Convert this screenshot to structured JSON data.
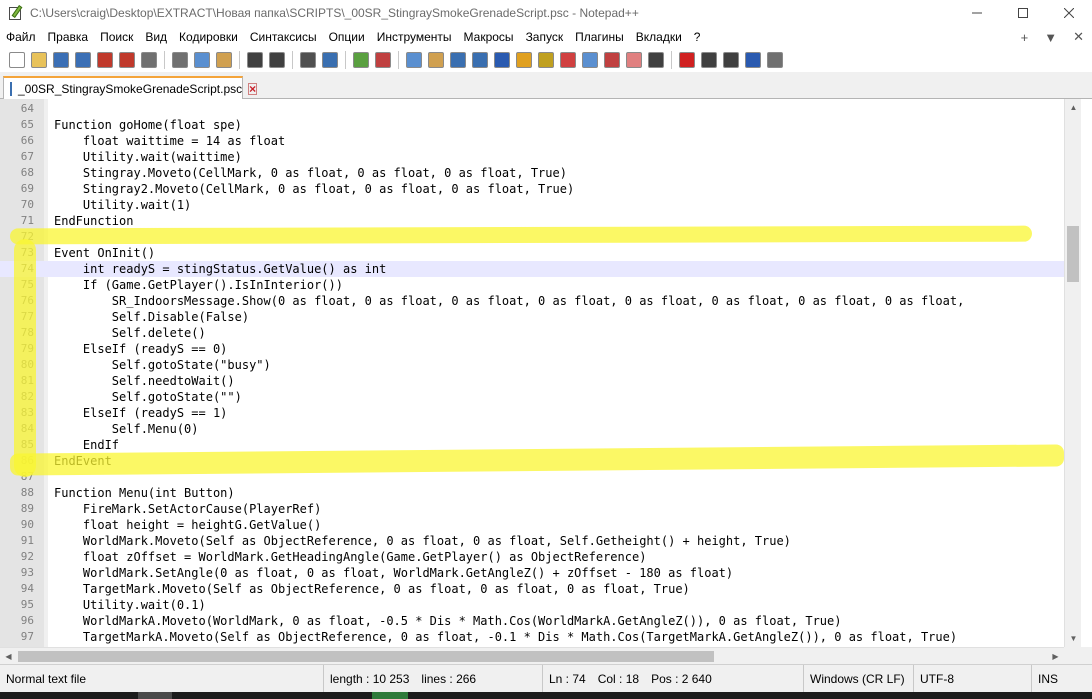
{
  "window": {
    "title": "C:\\Users\\craig\\Desktop\\EXTRACT\\Новая папка\\SCRIPTS\\_00SR_StingraySmokeGrenadeScript.psc - Notepad++",
    "controls": [
      "minimize-icon",
      "maximize-icon",
      "close-icon"
    ]
  },
  "menu": {
    "items": [
      "Файл",
      "Правка",
      "Поиск",
      "Вид",
      "Кодировки",
      "Синтаксисы",
      "Опции",
      "Инструменты",
      "Макросы",
      "Запуск",
      "Плагины",
      "Вкладки",
      "?"
    ],
    "right": [
      "+",
      "▼",
      "✕"
    ]
  },
  "toolbar": {
    "buttons": [
      {
        "name": "new-file-icon",
        "color": "#ffffff"
      },
      {
        "name": "open-file-icon",
        "color": "#e8c25a"
      },
      {
        "name": "save-icon",
        "color": "#3b6fb5"
      },
      {
        "name": "save-all-icon",
        "color": "#3b6fb5"
      },
      {
        "name": "close-file-icon",
        "color": "#c0392b"
      },
      {
        "name": "close-all-icon",
        "color": "#c0392b"
      },
      {
        "name": "print-icon",
        "color": "#707070"
      },
      {
        "sep": true
      },
      {
        "name": "cut-icon",
        "color": "#707070"
      },
      {
        "name": "copy-icon",
        "color": "#5a8fd0"
      },
      {
        "name": "paste-icon",
        "color": "#d0a050"
      },
      {
        "sep": true
      },
      {
        "name": "undo-icon",
        "color": "#404040"
      },
      {
        "name": "redo-icon",
        "color": "#404040"
      },
      {
        "sep": true
      },
      {
        "name": "find-icon",
        "color": "#505050"
      },
      {
        "name": "replace-icon",
        "color": "#3a6fb0"
      },
      {
        "sep": true
      },
      {
        "name": "zoom-in-icon",
        "color": "#5aa040"
      },
      {
        "name": "zoom-out-icon",
        "color": "#c04040"
      },
      {
        "sep": true
      },
      {
        "name": "sync-vertical-icon",
        "color": "#5a8fd0"
      },
      {
        "name": "sync-horizontal-icon",
        "color": "#d0a050"
      },
      {
        "name": "word-wrap-icon",
        "color": "#3a6fb0"
      },
      {
        "name": "show-all-chars-icon",
        "color": "#3a6fb0"
      },
      {
        "name": "indent-guide-icon",
        "color": "#2a5ab0"
      },
      {
        "name": "doc-map-icon",
        "color": "#e0a020"
      },
      {
        "name": "function-list-icon",
        "color": "#c0a020"
      },
      {
        "name": "folder-workspace-icon",
        "color": "#d04040"
      },
      {
        "name": "doc-list-icon",
        "color": "#5a8fd0"
      },
      {
        "name": "monitoring-icon",
        "color": "#c04040"
      },
      {
        "name": "folder-icon",
        "color": "#e08080"
      },
      {
        "name": "eye-icon",
        "color": "#404040"
      },
      {
        "sep": true
      },
      {
        "name": "record-macro-icon",
        "color": "#d02020"
      },
      {
        "name": "stop-macro-icon",
        "color": "#404040"
      },
      {
        "name": "play-macro-icon",
        "color": "#404040"
      },
      {
        "name": "play-multiple-icon",
        "color": "#2a5ab0"
      },
      {
        "name": "save-macro-icon",
        "color": "#707070"
      }
    ]
  },
  "tab": {
    "label": "_00SR_StingraySmokeGrenadeScript.psc",
    "accent": "#f4a43a"
  },
  "editor": {
    "current_line": "74",
    "highlight_color": "#faf632",
    "lines": [
      {
        "n": "64",
        "code": ""
      },
      {
        "n": "65",
        "code": "Function goHome(float spe)"
      },
      {
        "n": "66",
        "code": "    float waittime = 14 as float"
      },
      {
        "n": "67",
        "code": "    Utility.wait(waittime)"
      },
      {
        "n": "68",
        "code": "    Stingray.Moveto(CellMark, 0 as float, 0 as float, 0 as float, True)"
      },
      {
        "n": "69",
        "code": "    Stingray2.Moveto(CellMark, 0 as float, 0 as float, 0 as float, True)"
      },
      {
        "n": "70",
        "code": "    Utility.wait(1)"
      },
      {
        "n": "71",
        "code": "EndFunction"
      },
      {
        "n": "72",
        "code": ""
      },
      {
        "n": "73",
        "code": "Event OnInit()"
      },
      {
        "n": "74",
        "code": "    int readyS = stingStatus.GetValue() as int"
      },
      {
        "n": "75",
        "code": "    If (Game.GetPlayer().IsInInterior())"
      },
      {
        "n": "76",
        "code": "        SR_IndoorsMessage.Show(0 as float, 0 as float, 0 as float, 0 as float, 0 as float, 0 as float, 0 as float, 0 as float,"
      },
      {
        "n": "77",
        "code": "        Self.Disable(False)"
      },
      {
        "n": "78",
        "code": "        Self.delete()"
      },
      {
        "n": "79",
        "code": "    ElseIf (readyS == 0)"
      },
      {
        "n": "80",
        "code": "        Self.gotoState(\"busy\")"
      },
      {
        "n": "81",
        "code": "        Self.needtoWait()"
      },
      {
        "n": "82",
        "code": "        Self.gotoState(\"\")"
      },
      {
        "n": "83",
        "code": "    ElseIf (readyS == 1)"
      },
      {
        "n": "84",
        "code": "        Self.Menu(0)"
      },
      {
        "n": "85",
        "code": "    EndIf"
      },
      {
        "n": "86",
        "code": "EndEvent"
      },
      {
        "n": "87",
        "code": ""
      },
      {
        "n": "88",
        "code": "Function Menu(int Button)"
      },
      {
        "n": "89",
        "code": "    FireMark.SetActorCause(PlayerRef)"
      },
      {
        "n": "90",
        "code": "    float height = heightG.GetValue()"
      },
      {
        "n": "91",
        "code": "    WorldMark.Moveto(Self as ObjectReference, 0 as float, 0 as float, Self.Getheight() + height, True)"
      },
      {
        "n": "92",
        "code": "    float zOffset = WorldMark.GetHeadingAngle(Game.GetPlayer() as ObjectReference)"
      },
      {
        "n": "93",
        "code": "    WorldMark.SetAngle(0 as float, 0 as float, WorldMark.GetAngleZ() + zOffset - 180 as float)"
      },
      {
        "n": "94",
        "code": "    TargetMark.Moveto(Self as ObjectReference, 0 as float, 0 as float, 0 as float, True)"
      },
      {
        "n": "95",
        "code": "    Utility.wait(0.1)"
      },
      {
        "n": "96",
        "code": "    WorldMarkA.Moveto(WorldMark, 0 as float, -0.5 * Dis * Math.Cos(WorldMarkA.GetAngleZ()), 0 as float, True)"
      },
      {
        "n": "97",
        "code": "    TargetMarkA.Moveto(Self as ObjectReference, 0 as float, -0.1 * Dis * Math.Cos(TargetMarkA.GetAngleZ()), 0 as float, True)"
      }
    ]
  },
  "status": {
    "filetype": "Normal text file",
    "length": "length : 10 253",
    "lines": "lines : 266",
    "ln": "Ln : 74",
    "col": "Col : 18",
    "pos": "Pos : 2 640",
    "eol": "Windows (CR LF)",
    "encoding": "UTF-8",
    "mode": "INS"
  }
}
